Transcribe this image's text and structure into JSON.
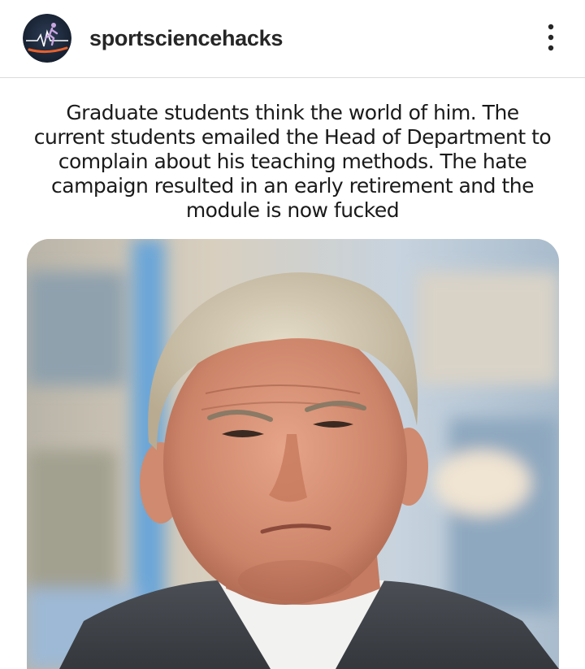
{
  "post": {
    "username": "sportsciencehacks",
    "avatar_icon": "runner-heartbeat-icon",
    "more_icon": "more-vertical-icon",
    "caption": "Graduate students think the world of him. The current students emailed the Head of Department to complain about his teaching methods. The hate campaign resulted in an early retirement and the module is now fucked"
  },
  "colors": {
    "avatar_bg": "#1d2a3d",
    "avatar_accent": "#e8612c",
    "text": "#262626",
    "divider": "#dbdbdb"
  }
}
